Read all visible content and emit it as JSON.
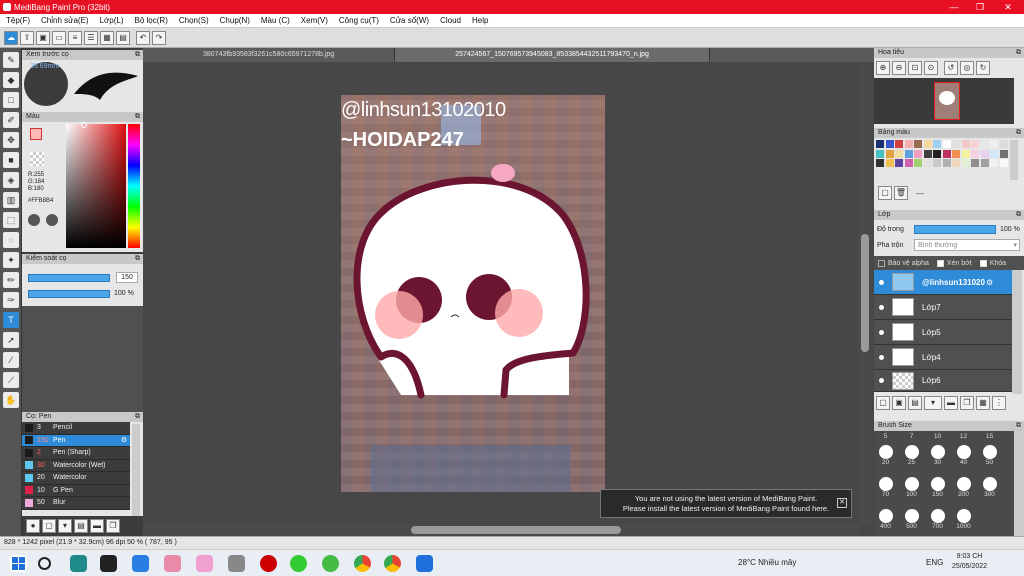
{
  "window": {
    "title": "MediBang Paint Pro (32bit)",
    "minimize": "—",
    "maximize": "❐",
    "close": "✕"
  },
  "menu": [
    "Tệp(F)",
    "Chỉnh sửa(E)",
    "Lớp(L)",
    "Bộ lọc(R)",
    "Chọn(S)",
    "Chụp(N)",
    "Màu (C)",
    "Xem(V)",
    "Công cụ(T)",
    "Cửa sổ(W)",
    "Cloud",
    "Help"
  ],
  "navigator": {
    "title": "Xem trước cọ",
    "size_label": "39.69mm"
  },
  "color_panel": {
    "title": "Màu",
    "r": "R:255",
    "g": "G:184",
    "b": "B:180",
    "hex": "#FFB8B4"
  },
  "brush_control": {
    "title": "Kiểm soát cọ",
    "size": "150",
    "opacity": "100 %"
  },
  "brush_list": {
    "title": "Cọ: Pen",
    "items": [
      {
        "num": "3",
        "name": "Pencil",
        "color": "#1a1a1a"
      },
      {
        "num": "150",
        "name": "Pen",
        "color": "#1a1a1a"
      },
      {
        "num": "2",
        "name": "Pen (Sharp)",
        "color": "#1a1a1a"
      },
      {
        "num": "30",
        "name": "Watercolor (Wet)",
        "color": "#5ec8f0"
      },
      {
        "num": "20",
        "name": "Watercolor",
        "color": "#5ec8f0"
      },
      {
        "num": "10",
        "name": "G Pen",
        "color": "#e0204a"
      },
      {
        "num": "50",
        "name": "Blur",
        "color": "#f0a8d8"
      }
    ]
  },
  "tabs": [
    "380743fb93583f3261c580c65971278b.jpg",
    "257424567_150769573945083_8533854432511793470_n.jpg"
  ],
  "canvas": {
    "line1": "@linhsun13102010",
    "line2": "~HOIDAP247",
    "face": "^"
  },
  "right": {
    "nav_title": "Hoa tiêu",
    "palette_title": "Bảng màu",
    "palette_dash": "---",
    "layer_title": "Lớp",
    "opacity_label": "Độ trong",
    "opacity_value": "100 %",
    "blend_label": "Pha trộn",
    "blend_value": "Bình thường",
    "protect_alpha": "Bảo vệ alpha",
    "clipping": "Xén bớt",
    "lock": "Khóa",
    "layers": [
      "@linhsun131020",
      "Lớp7",
      "Lớp5",
      "Lớp4",
      "Lớp6"
    ],
    "brush_size_title": "Brush Size",
    "top_sizes": [
      "5",
      "7",
      "10",
      "12",
      "15"
    ],
    "sizes": [
      "20",
      "25",
      "30",
      "40",
      "50",
      "70",
      "100",
      "150",
      "200",
      "300",
      "400",
      "500",
      "700",
      "1000"
    ]
  },
  "status": {
    "text": "828 * 1242 pixel   (21.9 * 32.9cm)   96 dpi   50 %   ( 787, 95 )"
  },
  "notice": {
    "line1": "You are not using the latest version of MediBang Paint.",
    "line2": "Please install the latest version of MediBang Paint found here."
  },
  "taskbar": {
    "weather": "28°C  Nhiều mây",
    "lang": "ENG",
    "time": "9:03 CH",
    "date": "25/05/2022"
  },
  "palette_colors": [
    "#1c2f6e",
    "#3a55c8",
    "#d04040",
    "#f2b0b0",
    "#9a6a50",
    "#f2d9a0",
    "#a0d0f0",
    "#ffffff",
    "#e0e0e0",
    "#f5c8c8",
    "#f8d0d8",
    "#e8e8e8",
    "#f0f0f0",
    "#dcdcdc",
    "#48c0c0",
    "#e0a040",
    "#f0e0a0",
    "#60a0e0",
    "#f0a0c0",
    "#404040",
    "#202020",
    "#c03060",
    "#f09050",
    "#f2f2a0",
    "#f5d0e0",
    "#e8d0f0",
    "#d0e8f8",
    "#707070",
    "#303030",
    "#f0c050",
    "#6040a0",
    "#d060b0",
    "#a0d070",
    "#e0e0e0",
    "#c8c8c8",
    "#b0b0b0",
    "#f0d8c0",
    "#e0f0d0",
    "#909090",
    "#a0a0a0",
    "#f0f0f0",
    "#f8f8f8"
  ]
}
